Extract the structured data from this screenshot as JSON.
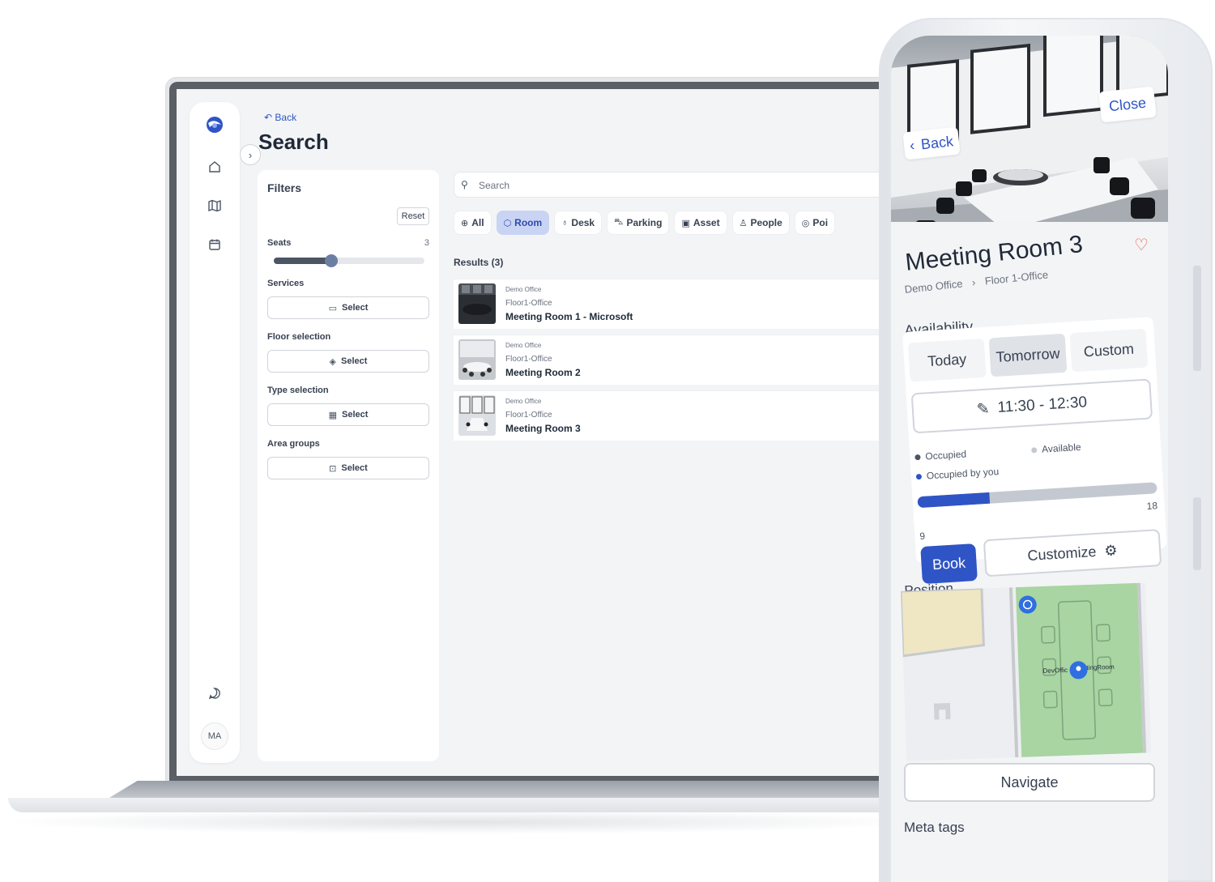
{
  "desktop": {
    "back_label": "Back",
    "page_title": "Search",
    "avatar_initials": "MA",
    "filters": {
      "title": "Filters",
      "reset_label": "Reset",
      "seats_label": "Seats",
      "seats_value": "3",
      "seats_fraction": 0.38,
      "services_label": "Services",
      "floor_label": "Floor selection",
      "type_label": "Type selection",
      "area_label": "Area groups",
      "select_label": "Select"
    },
    "search": {
      "placeholder": "Search"
    },
    "tabs": [
      {
        "label": "All",
        "icon": "globe-icon",
        "active": false
      },
      {
        "label": "Room",
        "icon": "cube-icon",
        "active": true
      },
      {
        "label": "Desk",
        "icon": "mic-icon",
        "active": false
      },
      {
        "label": "Parking",
        "icon": "car-icon",
        "active": false
      },
      {
        "label": "Asset",
        "icon": "asset-icon",
        "active": false
      },
      {
        "label": "People",
        "icon": "person-icon",
        "active": false
      },
      {
        "label": "Poi",
        "icon": "target-icon",
        "active": false
      }
    ],
    "results_label": "Results (3)",
    "results": [
      {
        "office": "Demo Office",
        "floor": "Floor1-Office",
        "name": "Meeting Room 1 - Microsoft"
      },
      {
        "office": "Demo Office",
        "floor": "Floor1-Office",
        "name": "Meeting Room 2"
      },
      {
        "office": "Demo Office",
        "floor": "Floor1-Office",
        "name": "Meeting Room 3"
      }
    ]
  },
  "mobile": {
    "back_label": "Back",
    "close_label": "Close",
    "title": "Meeting Room 3",
    "breadcrumb": [
      "Demo Office",
      "Floor 1-Office"
    ],
    "availability_label": "Availability",
    "segments": [
      {
        "label": "Today",
        "active": false
      },
      {
        "label": "Tomorrow",
        "active": true
      },
      {
        "label": "Custom",
        "active": false
      }
    ],
    "time_range": "11:30 - 12:30",
    "legend": {
      "occupied": "Occupied",
      "available": "Available",
      "occupied_by_you": "Occupied by you"
    },
    "occupancy": {
      "current": "9",
      "max": "18",
      "fraction": 0.3
    },
    "book_label": "Book",
    "customize_label": "Customize",
    "position_label": "Position",
    "map_labels": [
      "DevOffic",
      "tingRoom"
    ],
    "navigate_label": "Navigate",
    "meta_tags_label": "Meta tags"
  },
  "colors": {
    "primary": "#2f54c5",
    "active_tab_bg": "#c9d3f3",
    "heart": "#e35a4a",
    "map_green": "#a8d5a2"
  }
}
